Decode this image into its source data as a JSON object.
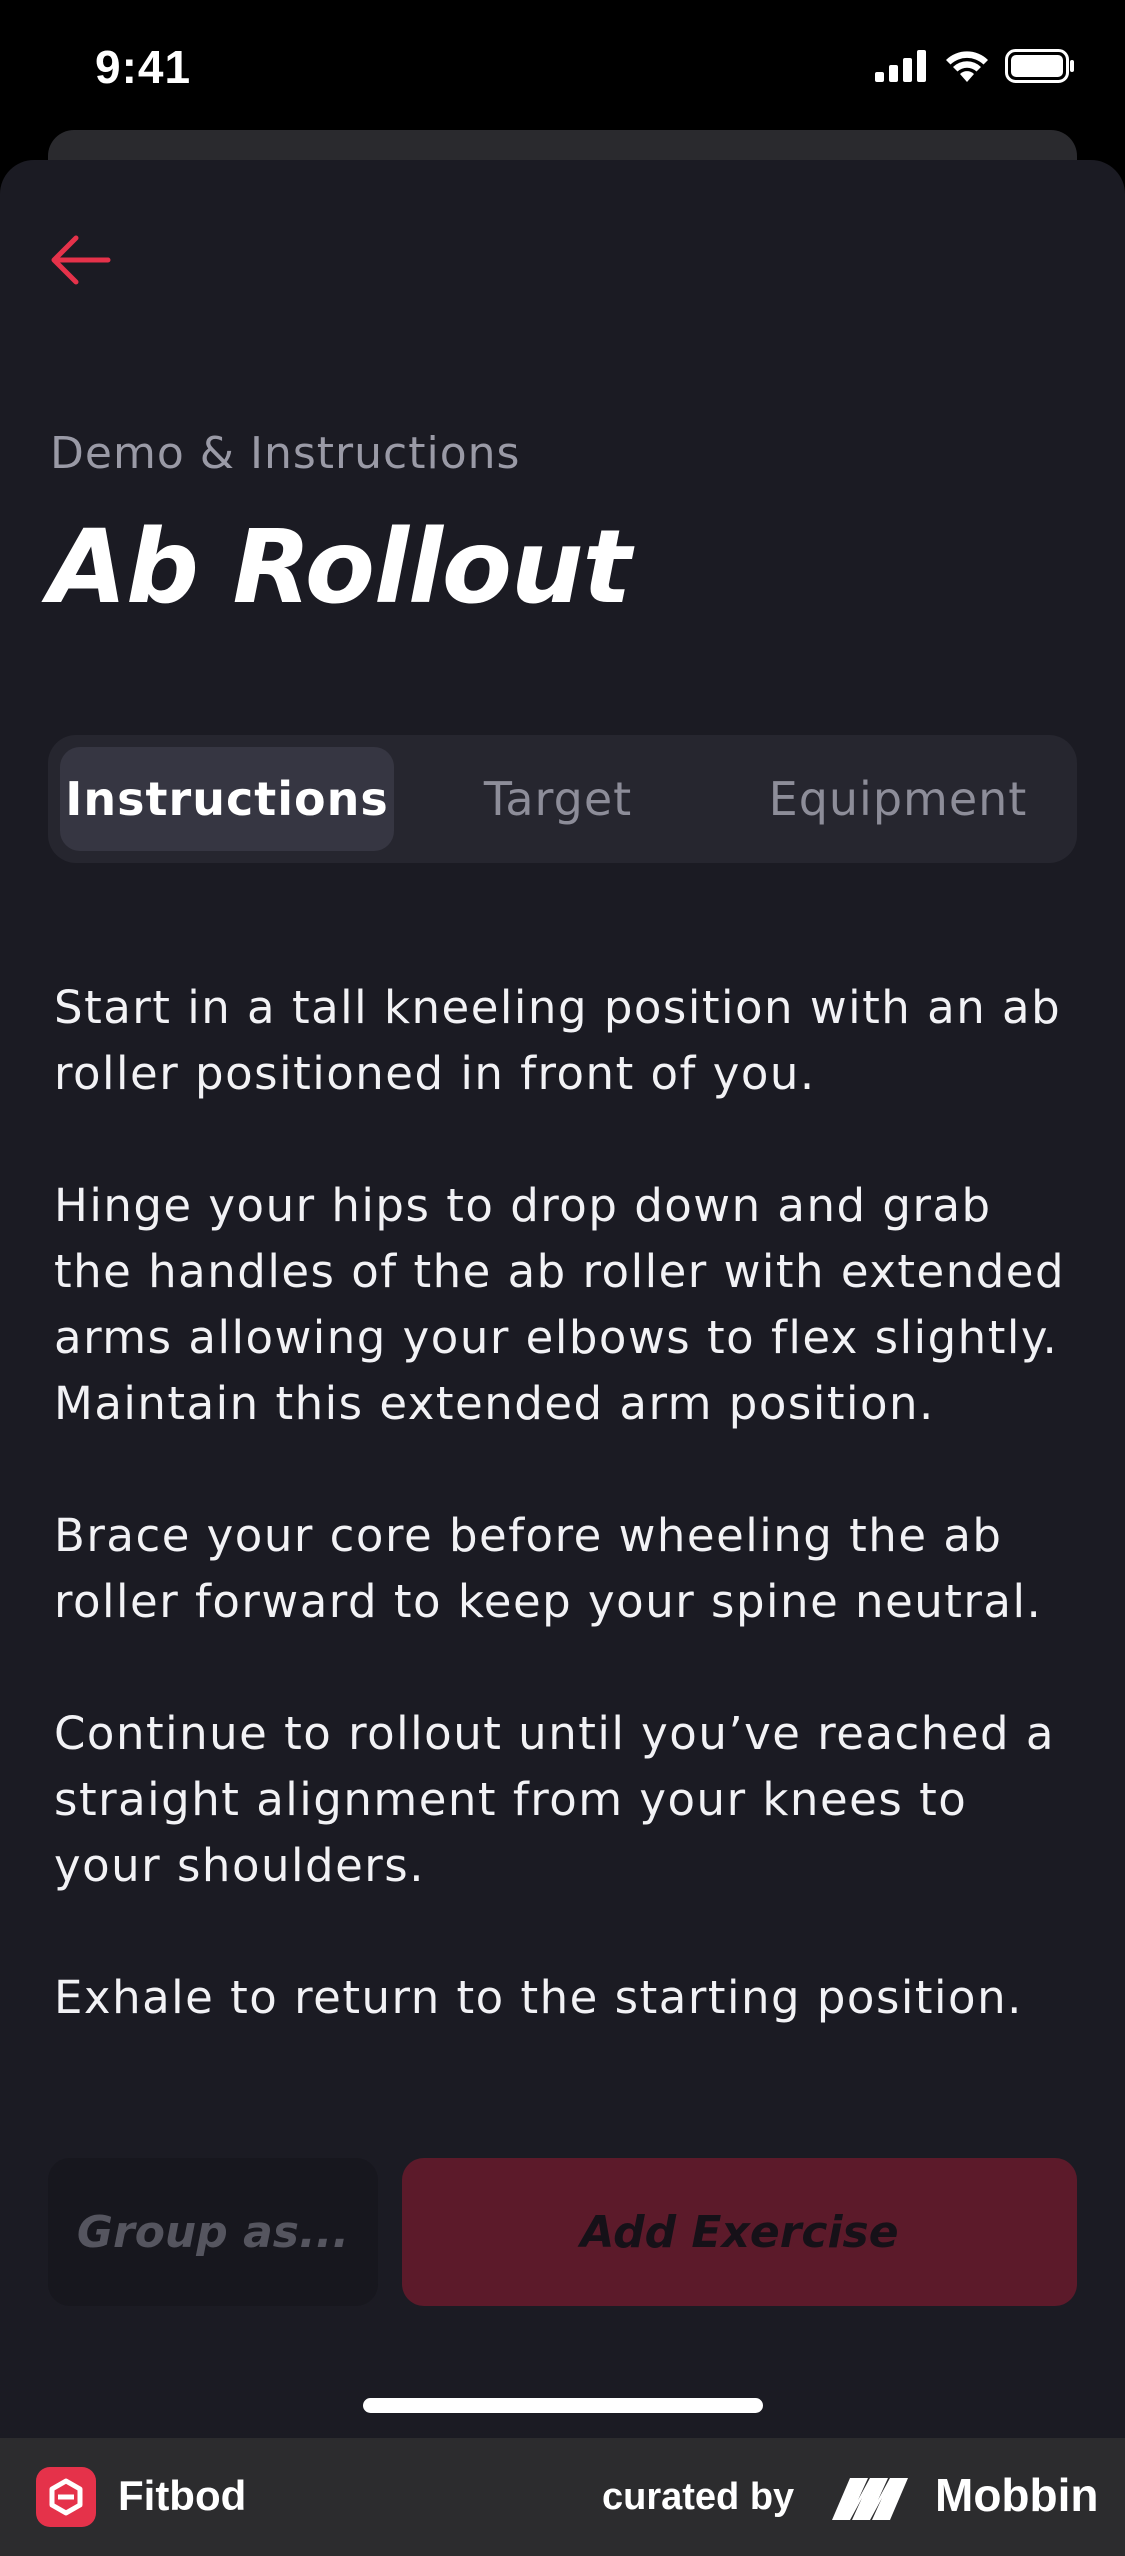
{
  "status_bar": {
    "time": "9:41"
  },
  "header": {
    "back_icon": "arrow-left-icon",
    "eyebrow": "Demo & Instructions",
    "title": "Ab Rollout"
  },
  "tabs": [
    {
      "label": "Instructions",
      "active": true
    },
    {
      "label": "Target",
      "active": false
    },
    {
      "label": "Equipment",
      "active": false
    }
  ],
  "instructions": [
    "Start in a tall kneeling position with an ab roller positioned in front of you.",
    "Hinge your hips to drop down and grab the handles of the ab roller with extended arms allowing your elbows to flex slightly. Maintain this extended arm position.",
    "Brace your core before wheeling the ab roller forward to keep your spine neutral.",
    "Continue to rollout until you’ve reached a straight alignment from your knees to your shoulders.",
    "Exhale to return to the starting position."
  ],
  "actions": {
    "group_label": "Group as...",
    "add_label": "Add Exercise"
  },
  "footer": {
    "app_name": "Fitbod",
    "curated_by": "curated by",
    "brand": "Mobbin"
  },
  "colors": {
    "accent": "#e5324a",
    "sheet_background": "#1b1b23",
    "add_button": "#5c1a2a"
  }
}
